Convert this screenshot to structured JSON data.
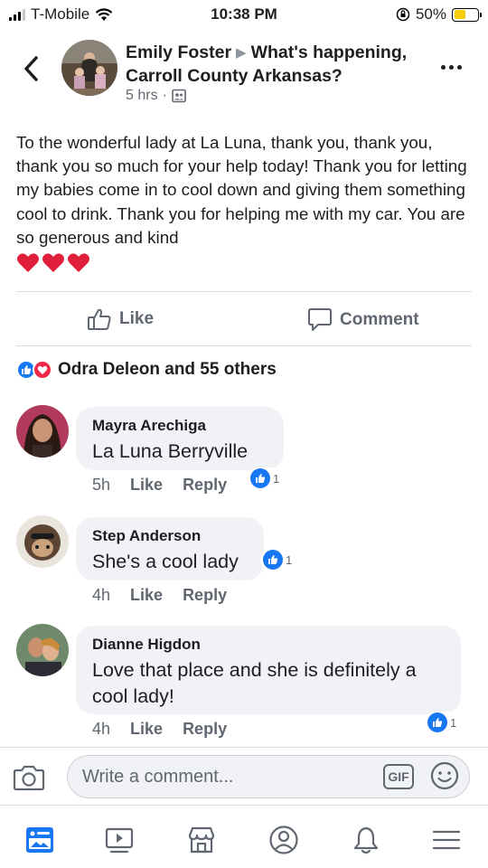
{
  "status_bar": {
    "carrier": "T-Mobile",
    "time": "10:38 PM",
    "battery_percent": "50%",
    "battery_level": 0.5,
    "battery_color": "#f7ce00"
  },
  "header": {
    "author": "Emily Foster",
    "group": "What's happening, Carroll County Arkansas?",
    "time_ago": "5 hrs",
    "separator": "·",
    "audience_icon": "group-audience-icon"
  },
  "post": {
    "text": "To the wonderful lady at La Luna, thank you, thank you, thank you so much for your help today! Thank you for letting my babies come in to cool down and giving them something cool to drink. Thank you for helping me with my car. You are so generous and kind",
    "hearts_count": 3,
    "heart_color": "#e0203a"
  },
  "actions": {
    "like_label": "Like",
    "comment_label": "Comment"
  },
  "reactions": {
    "summary": "Odra Deleon and 55 others",
    "like_color": "#1877f2",
    "love_color": "#f0284a"
  },
  "comments": [
    {
      "name": "Mayra Arechiga",
      "text": "La Luna Berryville",
      "time": "5h",
      "like_label": "Like",
      "reply_label": "Reply",
      "reactions": "1"
    },
    {
      "name": "Step Anderson",
      "text": "She's a cool lady",
      "time": "4h",
      "like_label": "Like",
      "reply_label": "Reply",
      "reactions": "1"
    },
    {
      "name": "Dianne Higdon",
      "text": "Love that place and she is definitely a cool lady!",
      "time": "4h",
      "like_label": "Like",
      "reply_label": "Reply",
      "reactions": "1"
    }
  ],
  "composer": {
    "placeholder": "Write a comment...",
    "gif_label": "GIF"
  },
  "bottom_nav": {
    "items": [
      "news-feed-icon",
      "watch-icon",
      "marketplace-icon",
      "profile-icon",
      "notifications-icon",
      "menu-icon"
    ],
    "active_color": "#1877f2",
    "inactive_color": "#606770"
  }
}
